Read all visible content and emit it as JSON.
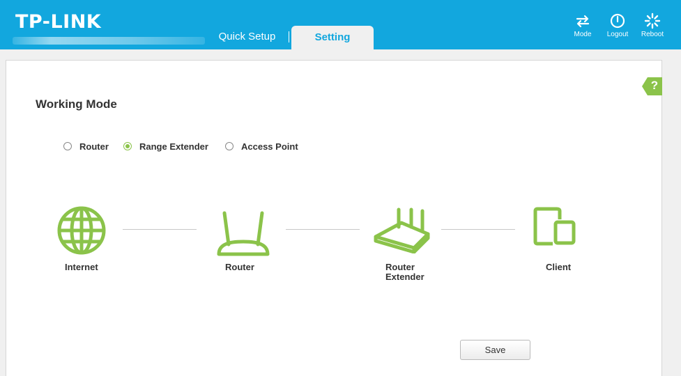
{
  "header": {
    "brand": "TP-LINK",
    "tabs": [
      {
        "label": "Quick Setup",
        "active": false
      },
      {
        "label": "Setting",
        "active": true
      }
    ],
    "actions": [
      {
        "label": "Mode",
        "icon": "swap-arrows-icon"
      },
      {
        "label": "Logout",
        "icon": "power-icon"
      },
      {
        "label": "Reboot",
        "icon": "spinner-icon"
      }
    ]
  },
  "page": {
    "title": "Working Mode",
    "help_label": "?",
    "modes": [
      {
        "label": "Router",
        "selected": false
      },
      {
        "label": "Range Extender",
        "selected": true
      },
      {
        "label": "Access Point",
        "selected": false
      }
    ],
    "diagram": [
      {
        "label": "Internet",
        "icon": "globe-icon"
      },
      {
        "label": "Router",
        "icon": "router-icon"
      },
      {
        "label": "Router Extender",
        "icon": "range-extender-icon"
      },
      {
        "label": "Client",
        "icon": "client-devices-icon"
      }
    ],
    "save_label": "Save"
  },
  "colors": {
    "header": "#12a7de",
    "accent_green": "#8bc34a",
    "background": "#f0f0f0"
  }
}
